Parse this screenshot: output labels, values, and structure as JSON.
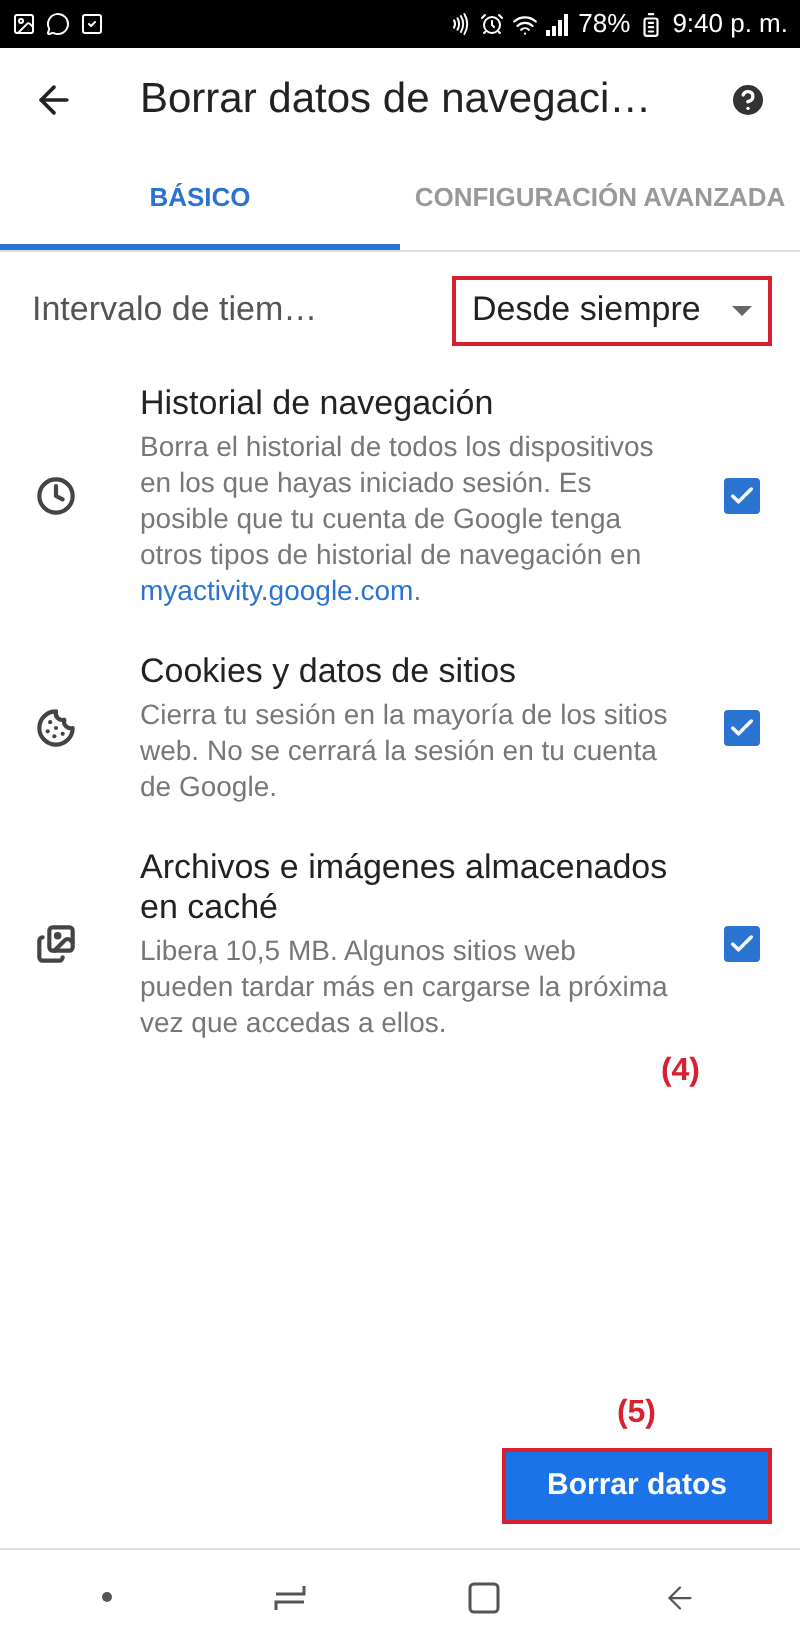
{
  "status_bar": {
    "battery": "78%",
    "time": "9:40 p. m."
  },
  "header": {
    "title": "Borrar datos de navegaci…"
  },
  "tabs": [
    {
      "label": "BÁSICO",
      "selected": true
    },
    {
      "label": "CONFIGURACIÓN AVANZADA",
      "selected": false
    }
  ],
  "interval": {
    "label": "Intervalo de tiem…",
    "value": "Desde siempre",
    "highlighted": true
  },
  "items": [
    {
      "kind": "history",
      "title": "Historial de navegación",
      "description": "Borra el historial de todos los dispositivos en los que hayas iniciado sesión. Es posible que tu cuenta de Google tenga otros tipos de historial de navegación en",
      "link": "myactivity.google.com",
      "suffix": ".",
      "checked": true
    },
    {
      "kind": "cookies",
      "title": "Cookies y datos de sitios",
      "description": "Cierra tu sesión en la mayoría de los sitios web. No se cerrará la sesión en tu cuenta de Google.",
      "checked": true
    },
    {
      "kind": "cache",
      "title": "Archivos e imágenes almacenados en caché",
      "description": "Libera 10,5 MB. Algunos sitios web pueden tardar más en cargarse la próxima vez que accedas a ellos.",
      "checked": true
    }
  ],
  "annotations": [
    "(4)",
    "(5)"
  ],
  "button": {
    "label": "Borrar datos",
    "highlighted": true
  }
}
